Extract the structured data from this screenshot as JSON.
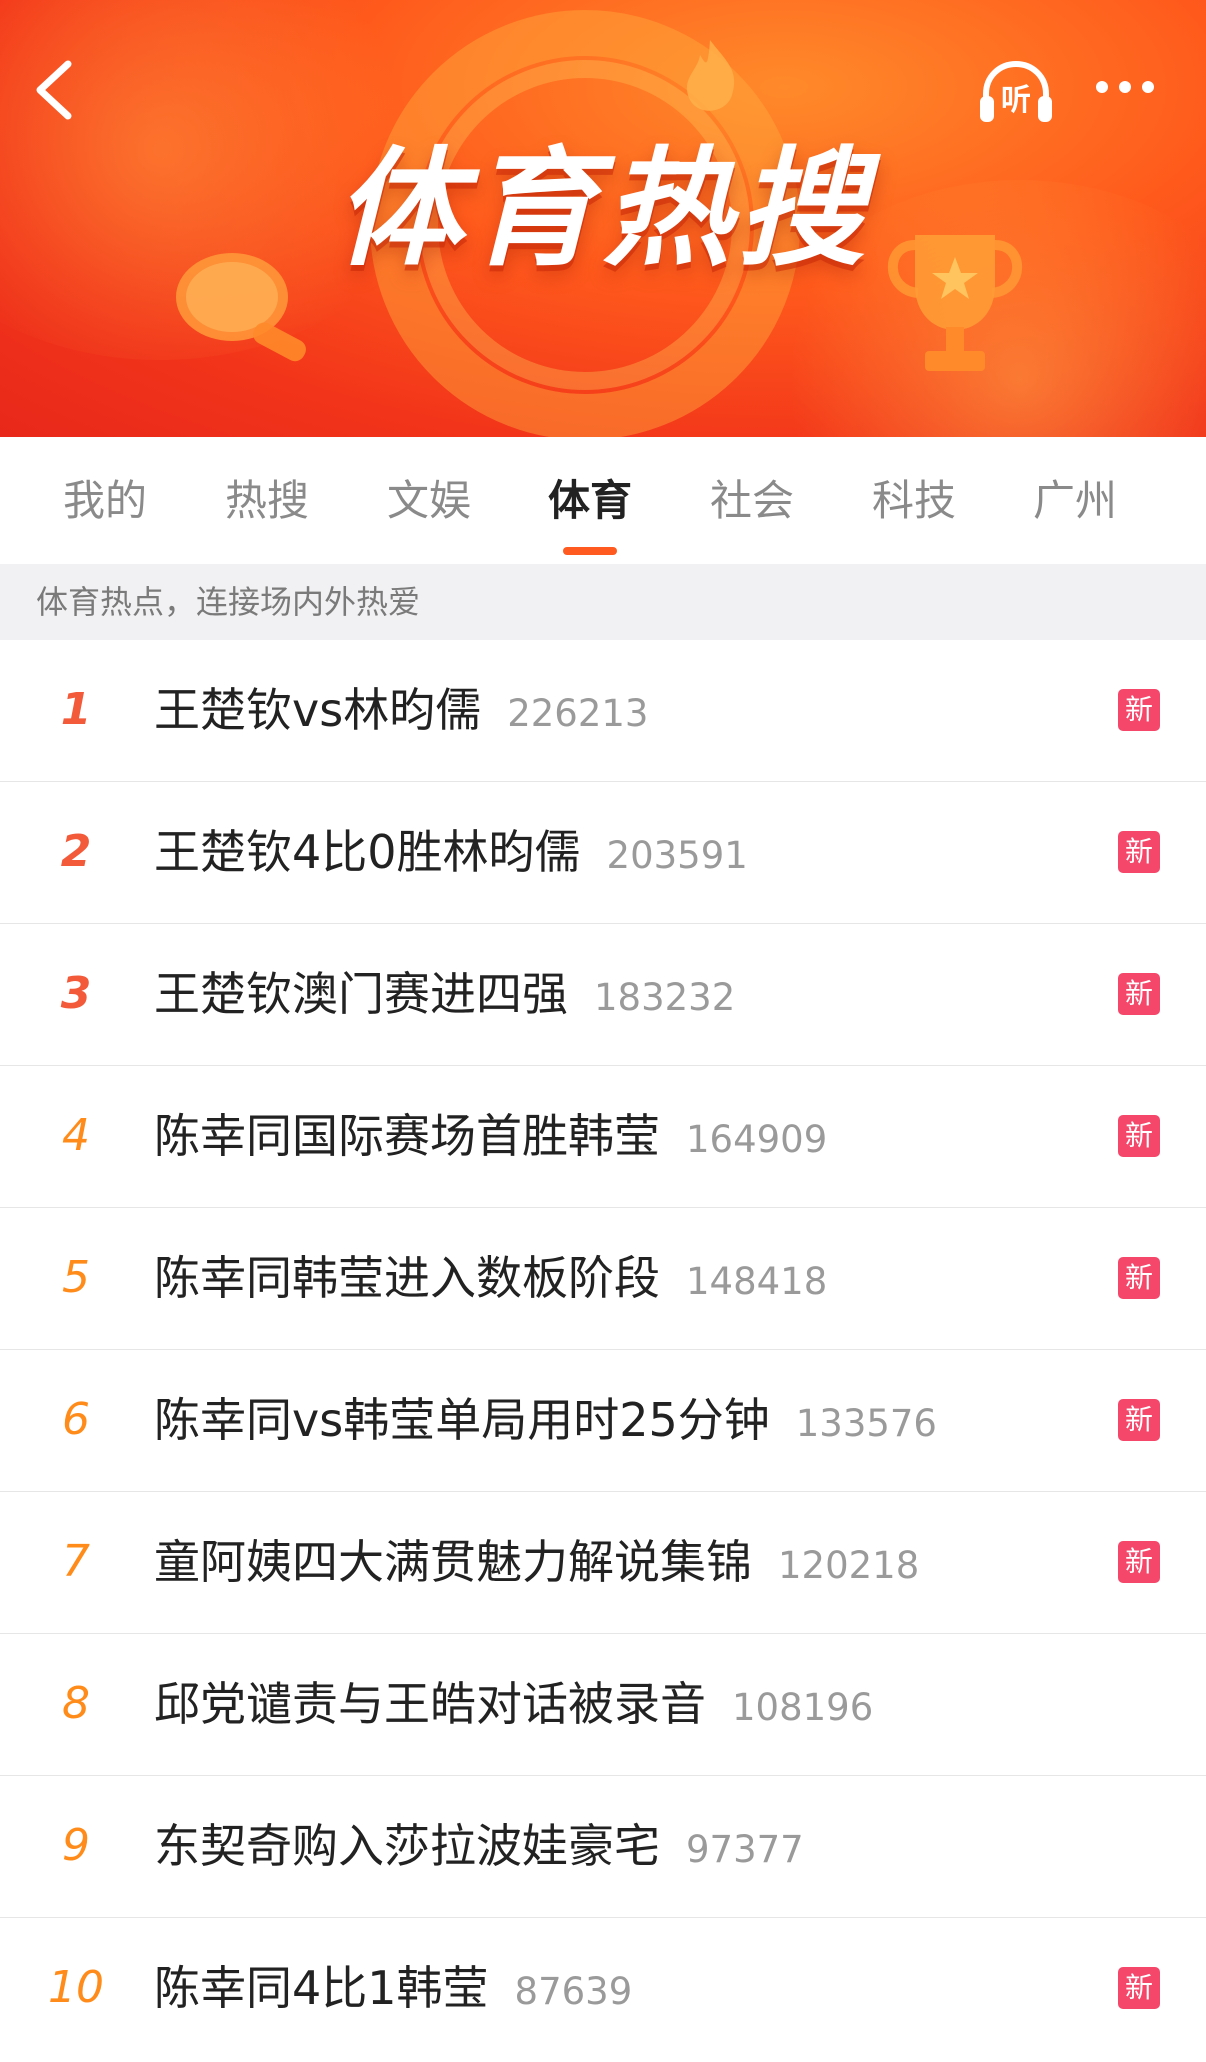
{
  "banner": {
    "title": "体育热搜",
    "listen_label": "听"
  },
  "tabs": [
    {
      "label": "我的"
    },
    {
      "label": "热搜"
    },
    {
      "label": "文娱"
    },
    {
      "label": "体育",
      "active": true
    },
    {
      "label": "社会"
    },
    {
      "label": "科技"
    },
    {
      "label": "广州"
    }
  ],
  "subtitle": "体育热点，连接场内外热爱",
  "list": [
    {
      "rank": "1",
      "title": "王楚钦vs林昀儒",
      "count": "226213",
      "badge": "新"
    },
    {
      "rank": "2",
      "title": "王楚钦4比0胜林昀儒",
      "count": "203591",
      "badge": "新"
    },
    {
      "rank": "3",
      "title": "王楚钦澳门赛进四强",
      "count": "183232",
      "badge": "新"
    },
    {
      "rank": "4",
      "title": "陈幸同国际赛场首胜韩莹",
      "count": "164909",
      "badge": "新"
    },
    {
      "rank": "5",
      "title": "陈幸同韩莹进入数板阶段",
      "count": "148418",
      "badge": "新"
    },
    {
      "rank": "6",
      "title": "陈幸同vs韩莹单局用时25分钟",
      "count": "133576",
      "badge": "新"
    },
    {
      "rank": "7",
      "title": "童阿姨四大满贯魅力解说集锦",
      "count": "120218",
      "badge": "新"
    },
    {
      "rank": "8",
      "title": "邱党谴责与王皓对话被录音",
      "count": "108196",
      "badge": ""
    },
    {
      "rank": "9",
      "title": "东契奇购入莎拉波娃豪宅",
      "count": "97377",
      "badge": ""
    },
    {
      "rank": "10",
      "title": "陈幸同4比1韩莹",
      "count": "87639",
      "badge": "新"
    }
  ],
  "colors": {
    "accent": "#ff5a1f",
    "rank_top": "#f25a3a",
    "rank_other": "#ff8c1a",
    "new_badge": "#f4476a"
  },
  "icons": {
    "back": "chevron-left-icon",
    "listen": "headphones-icon",
    "more": "more-dots-icon"
  }
}
